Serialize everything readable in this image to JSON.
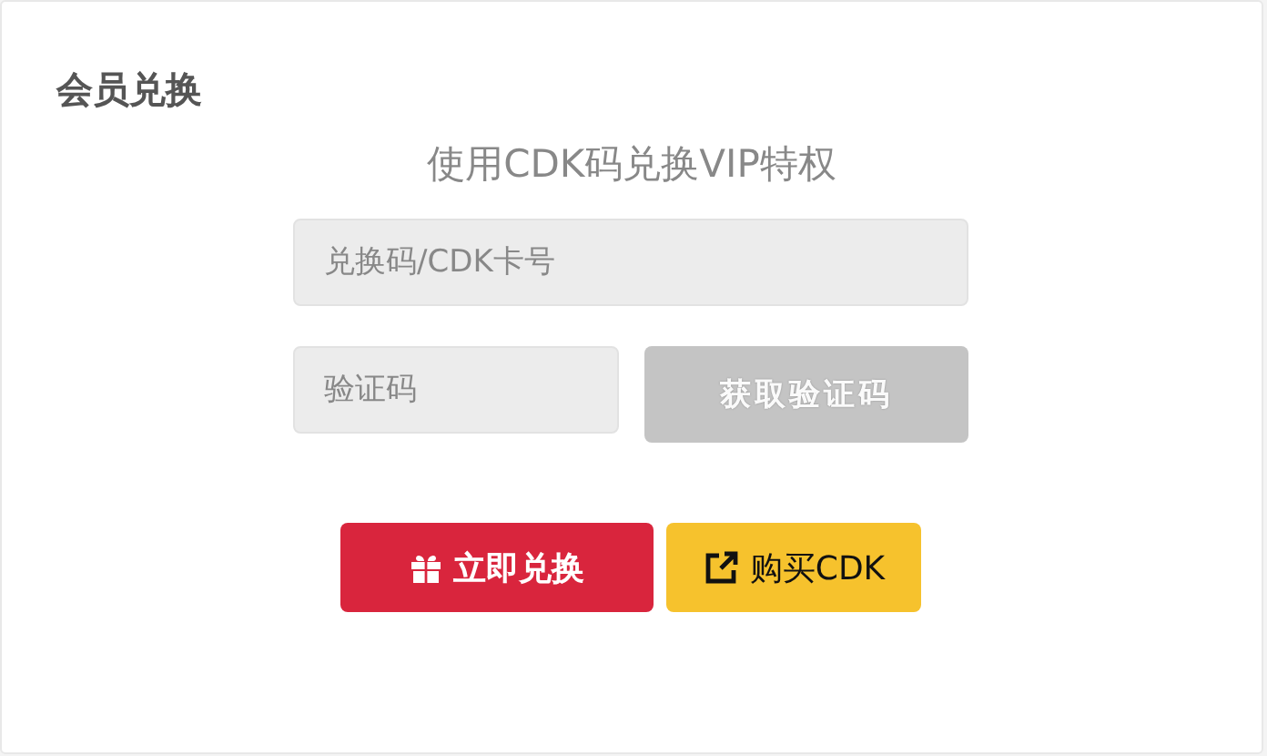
{
  "title": "会员兑换",
  "subtitle": "使用CDK码兑换VIP特权",
  "cdk_field": {
    "placeholder": "兑换码/CDK卡号"
  },
  "code_field": {
    "placeholder": "验证码"
  },
  "get_code_button": {
    "label": "获取验证码",
    "disabled": true
  },
  "buttons": [
    {
      "kind": "redeem",
      "label": "立即兑换"
    },
    {
      "kind": "buy",
      "label": "购买CDK"
    }
  ]
}
